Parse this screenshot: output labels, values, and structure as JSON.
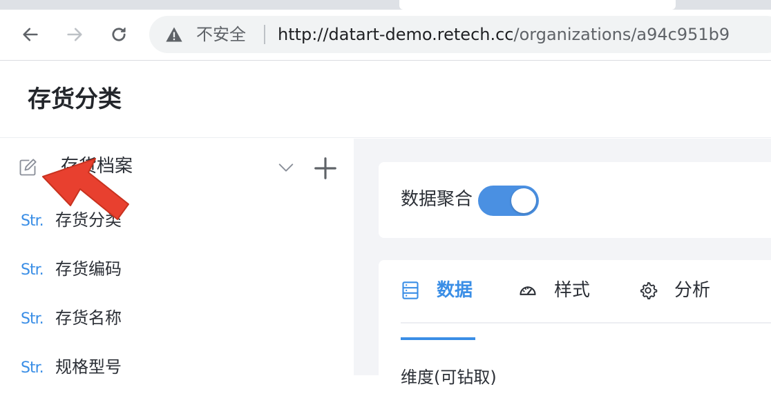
{
  "browser": {
    "security_label": "不安全",
    "url_host": "http://datart-demo.retech.cc",
    "url_path": "/organizations/a94c951b9"
  },
  "app": {
    "title": "存货分类"
  },
  "data_source": {
    "name": "存货档案",
    "fields": [
      {
        "type": "Str.",
        "name": "存货分类"
      },
      {
        "type": "Str.",
        "name": "存货编码"
      },
      {
        "type": "Str.",
        "name": "存货名称"
      },
      {
        "type": "Str.",
        "name": "规格型号"
      }
    ]
  },
  "config": {
    "aggregate_label": "数据聚合",
    "aggregate_enabled": true,
    "tabs": [
      {
        "label": "数据",
        "icon": "database-icon",
        "active": true
      },
      {
        "label": "样式",
        "icon": "dashboard-icon",
        "active": false
      },
      {
        "label": "分析",
        "icon": "gear-icon",
        "active": false
      }
    ],
    "section_title": "维度(可钻取)"
  },
  "colors": {
    "accent": "#3a8ee6",
    "toggle_on": "#4a90e2",
    "annotation_arrow": "#e8402f"
  }
}
